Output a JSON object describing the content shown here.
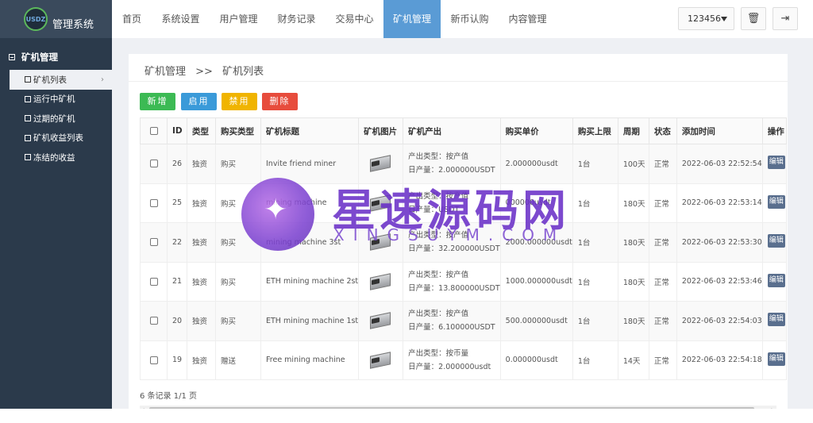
{
  "app": {
    "logo_text": "管理系统",
    "logo_mark": "USDZ"
  },
  "sidebar": {
    "section_title": "矿机管理",
    "items": [
      {
        "label": "矿机列表"
      },
      {
        "label": "运行中矿机"
      },
      {
        "label": "过期的矿机"
      },
      {
        "label": "矿机收益列表"
      },
      {
        "label": "冻结的收益"
      }
    ]
  },
  "topnav": {
    "items": [
      {
        "label": "首页"
      },
      {
        "label": "系统设置"
      },
      {
        "label": "用户管理"
      },
      {
        "label": "财务记录"
      },
      {
        "label": "交易中心"
      },
      {
        "label": "矿机管理"
      },
      {
        "label": "新币认购"
      },
      {
        "label": "内容管理"
      }
    ],
    "active": "矿机管理",
    "user": "123456",
    "trash_icon": "🗑",
    "logout_icon": "⇥"
  },
  "breadcrumb": {
    "parent": "矿机管理",
    "sep": ">>",
    "current": "矿机列表"
  },
  "toolbar": {
    "add": "新增",
    "enable": "启用",
    "disable": "禁用",
    "delete": "删除",
    "colors": {
      "add": "#3cba54",
      "enable": "#3a9ad9",
      "disable": "#f0b400",
      "delete": "#e74c3c"
    }
  },
  "table": {
    "headers": [
      "ID",
      "类型",
      "购买类型",
      "矿机标题",
      "矿机图片",
      "矿机产出",
      "购买单价",
      "购买上限",
      "周期",
      "状态",
      "添加时间",
      "操作"
    ],
    "rows": [
      {
        "id": "26",
        "type": "独资",
        "buy_type": "购买",
        "title": "Invite friend miner",
        "out1": "产出类型：按产值",
        "out2": "日产量：2.000000USDT",
        "price": "2.000000usdt",
        "limit": "1台",
        "cycle": "100天",
        "status": "正常",
        "time": "2022-06-03 22:52:54",
        "op": "编辑"
      },
      {
        "id": "25",
        "type": "独资",
        "buy_type": "购买",
        "title": "mining machine",
        "out1": "产出类型：按产值",
        "out2": "日产量：USDT",
        "price": "000000usdt",
        "limit": "1台",
        "cycle": "180天",
        "status": "正常",
        "time": "2022-06-03 22:53:14",
        "op": "编辑"
      },
      {
        "id": "22",
        "type": "独资",
        "buy_type": "购买",
        "title": "mining machine 3st",
        "out1": "产出类型：按产值",
        "out2": "日产量：32.200000USDT",
        "price": "2000.000000usdt",
        "limit": "1台",
        "cycle": "180天",
        "status": "正常",
        "time": "2022-06-03 22:53:30",
        "op": "编辑"
      },
      {
        "id": "21",
        "type": "独资",
        "buy_type": "购买",
        "title": "ETH mining machine 2st",
        "out1": "产出类型：按产值",
        "out2": "日产量：13.800000USDT",
        "price": "1000.000000usdt",
        "limit": "1台",
        "cycle": "180天",
        "status": "正常",
        "time": "2022-06-03 22:53:46",
        "op": "编辑"
      },
      {
        "id": "20",
        "type": "独资",
        "buy_type": "购买",
        "title": "ETH mining machine 1st",
        "out1": "产出类型：按产值",
        "out2": "日产量：6.100000USDT",
        "price": "500.000000usdt",
        "limit": "1台",
        "cycle": "180天",
        "status": "正常",
        "time": "2022-06-03 22:54:03",
        "op": "编辑"
      },
      {
        "id": "19",
        "type": "独资",
        "buy_type": "赠送",
        "title": "Free mining machine",
        "out1": "产出类型：按币量",
        "out2": "日产量：2.000000usdt",
        "price": "0.000000usdt",
        "limit": "1台",
        "cycle": "14天",
        "status": "正常",
        "time": "2022-06-03 22:54:18",
        "op": "编辑"
      }
    ]
  },
  "footer": {
    "records": "6 条记录 1/1 页"
  },
  "watermark": {
    "title": "星速源码网",
    "sub": "XINGSUYM.COM"
  }
}
